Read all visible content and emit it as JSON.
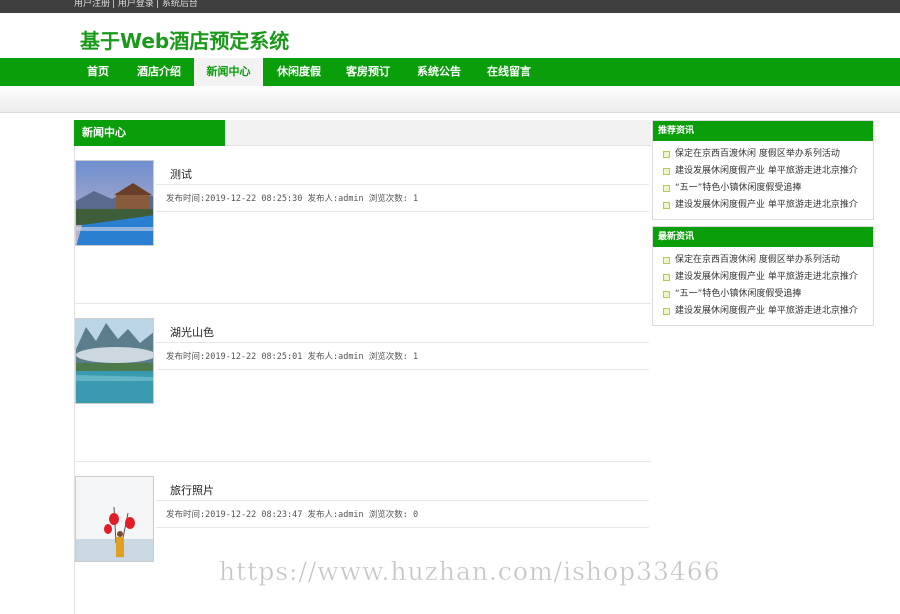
{
  "topbar": {
    "links": [
      "用户注册",
      "用户登录",
      "系统后台"
    ]
  },
  "header": {
    "title": "基于Web酒店预定系统"
  },
  "nav": {
    "items": [
      {
        "label": "首页"
      },
      {
        "label": "酒店介绍"
      },
      {
        "label": "新闻中心",
        "active": true
      },
      {
        "label": "休闲度假"
      },
      {
        "label": "客房预订"
      },
      {
        "label": "系统公告"
      },
      {
        "label": "在线留言"
      }
    ]
  },
  "main": {
    "section_title": "新闻中心",
    "news": [
      {
        "title": "测试",
        "meta": "发布时间:2019-12-22 08:25:30 发布人:admin 浏览次数: 1",
        "thumb": "hotel-pool-icon"
      },
      {
        "title": "湖光山色",
        "meta": "发布时间:2019-12-22 08:25:01 发布人:admin 浏览次数: 1",
        "thumb": "lake-mountain-icon"
      },
      {
        "title": "旅行照片",
        "meta": "发布时间:2019-12-22 08:23:47 发布人:admin 浏览次数: 0",
        "thumb": "travel-photo-icon"
      }
    ]
  },
  "sidebar": {
    "recommended": {
      "title": "推荐资讯",
      "items": [
        "保定在京西百渡休闲 度假区举办系列活动",
        "建设发展休闲度假产业 单平旅游走进北京推介",
        "“五一”特色小镇休闲度假受追捧",
        "建设发展休闲度假产业 单平旅游走进北京推介"
      ]
    },
    "latest": {
      "title": "最新资讯",
      "items": [
        "保定在京西百渡休闲 度假区举办系列活动",
        "建设发展休闲度假产业 单平旅游走进北京推介",
        "“五一”特色小镇休闲度假受追捧",
        "建设发展休闲度假产业 单平旅游走进北京推介"
      ]
    }
  },
  "watermark": "https://www.huzhan.com/ishop33466",
  "colors": {
    "brand_green": "#0a9e0a",
    "title_green": "#1a9a1a",
    "topbar": "#3f3f3f"
  }
}
